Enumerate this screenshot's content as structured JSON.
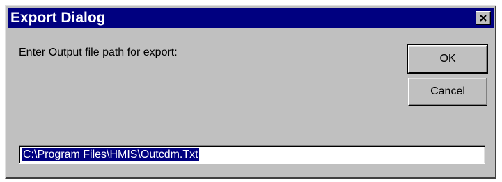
{
  "window": {
    "title": "Export Dialog",
    "close_icon": "close-x-icon"
  },
  "content": {
    "prompt": "Enter Output file path for export:",
    "output_path_value": "C:\\Program Files\\HMIS\\Outcdm.Txt",
    "output_path_selected": true
  },
  "buttons": {
    "ok_label": "OK",
    "cancel_label": "Cancel"
  },
  "colors": {
    "titlebar": "#000080",
    "dialog_face": "#c0c0c0",
    "selection": "#000080"
  }
}
